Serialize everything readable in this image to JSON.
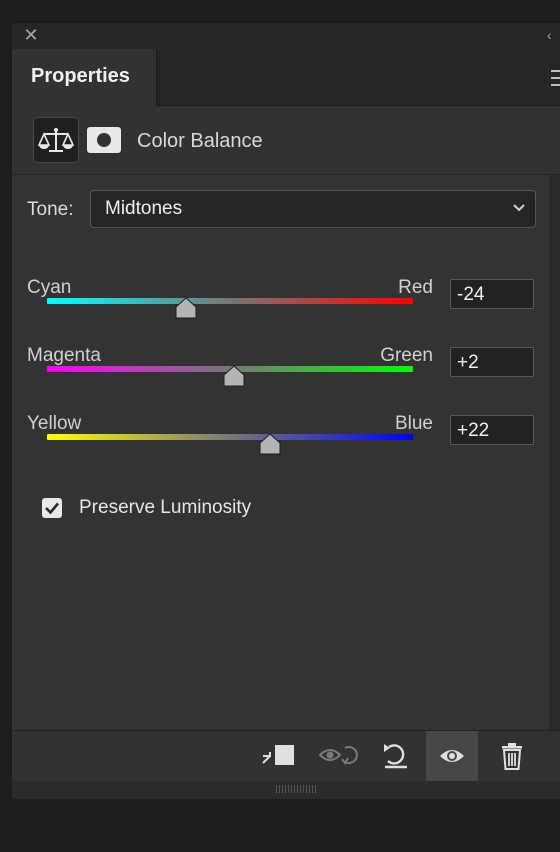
{
  "panel": {
    "tab_label": "Properties",
    "adjustment_title": "Color Balance"
  },
  "icons": {
    "close": "close-icon",
    "collapse": "double-chevron-left-icon",
    "menu": "hamburger-menu-icon",
    "balance": "balance-scale-icon",
    "mask": "layer-mask-icon",
    "chevron": "chevron-down-icon"
  },
  "tone": {
    "label": "Tone:",
    "selected": "Midtones"
  },
  "sliders": [
    {
      "left": "Cyan",
      "right": "Red",
      "value": "-24",
      "numeric": -24,
      "min": -100,
      "max": 100,
      "gradient": [
        "#00ffff",
        "#ff0000"
      ]
    },
    {
      "left": "Magenta",
      "right": "Green",
      "value": "+2",
      "numeric": 2,
      "min": -100,
      "max": 100,
      "gradient": [
        "#ff00ff",
        "#00ff00"
      ]
    },
    {
      "left": "Yellow",
      "right": "Blue",
      "value": "+22",
      "numeric": 22,
      "min": -100,
      "max": 100,
      "gradient": [
        "#ffff00",
        "#0000ff"
      ]
    }
  ],
  "preserve_luminosity": {
    "label": "Preserve Luminosity",
    "checked": true
  },
  "footer": {
    "buttons": [
      {
        "name": "clip-to-layer-icon",
        "active": false
      },
      {
        "name": "view-previous-state-icon",
        "active": false
      },
      {
        "name": "reset-icon",
        "active": false
      },
      {
        "name": "visibility-eye-icon",
        "active": true
      },
      {
        "name": "trash-icon",
        "active": false
      }
    ]
  },
  "colors": {
    "panel_bg": "#323232",
    "titlebar_bg": "#262626",
    "field_bg": "#222222",
    "text": "#e6e6e6"
  }
}
